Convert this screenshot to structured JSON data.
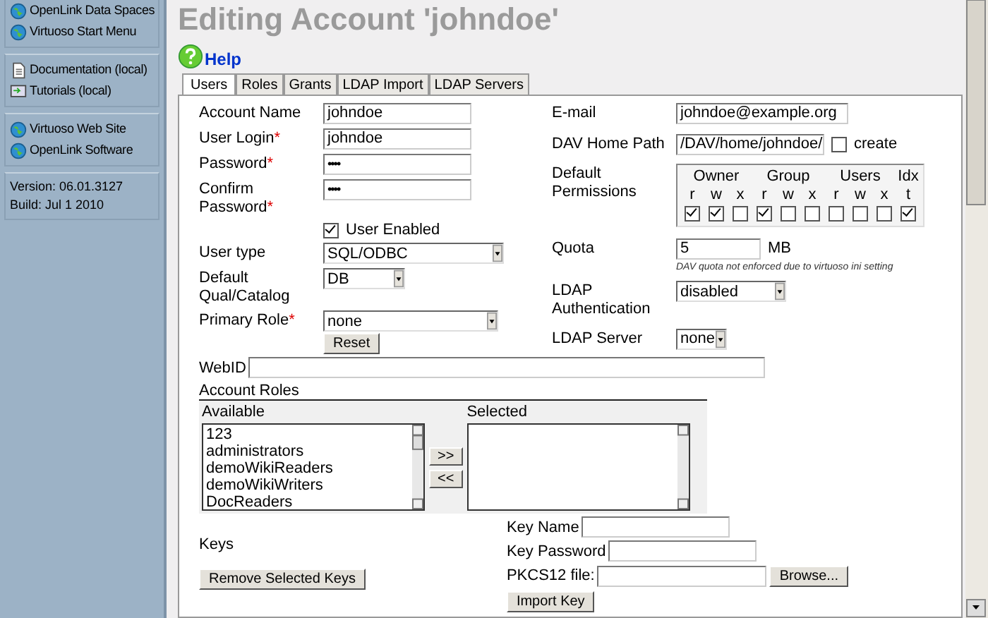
{
  "sidebar": {
    "groups": [
      {
        "items": [
          {
            "label": "OpenLink Data Spaces",
            "kind": "globe"
          },
          {
            "label": "Virtuoso Start Menu",
            "kind": "globe"
          }
        ]
      },
      {
        "items": [
          {
            "label": "Documentation (local)",
            "kind": "document"
          },
          {
            "label": "Tutorials (local)",
            "kind": "tutorial"
          }
        ]
      },
      {
        "items": [
          {
            "label": "Virtuoso Web Site",
            "kind": "globe"
          },
          {
            "label": "OpenLink Software",
            "kind": "globe"
          }
        ]
      }
    ],
    "version": [
      "Version: 06.01.3127",
      "Build: Jul 1 2010"
    ]
  },
  "title": "Editing Account 'johndoe'",
  "help": "Help",
  "tabs": [
    {
      "label": "Users",
      "selected": true
    },
    {
      "label": "Roles",
      "selected": false
    },
    {
      "label": "Grants",
      "selected": false
    },
    {
      "label": "LDAP Import",
      "selected": false
    },
    {
      "label": "LDAP Servers",
      "selected": false
    }
  ],
  "left_fields": [
    {
      "kind": "text",
      "label": "Account Name",
      "value": "johndoe"
    },
    {
      "kind": "text",
      "label": "User Login",
      "mark": "*",
      "value": "johndoe"
    },
    {
      "kind": "password",
      "label": "Password",
      "mark": "*",
      "value": "••••"
    },
    {
      "kind": "password",
      "label": "Confirm Password",
      "mark": "*",
      "value": "••••"
    },
    {
      "kind": "checkbox",
      "label": "User Enabled",
      "checked": true
    },
    {
      "kind": "select",
      "label": "User type",
      "value": "SQL/ODBC"
    },
    {
      "kind": "select",
      "label": "Default Qual/Catalog",
      "value": "DB"
    },
    {
      "kind": "select",
      "label": "Primary Role",
      "mark": "*",
      "value": "none",
      "button": "Reset"
    }
  ],
  "right_fields": [
    {
      "kind": "text",
      "label": "E-mail",
      "value": "johndoe@example.org"
    },
    {
      "kind": "text",
      "label": "DAV Home Path",
      "value": "/DAV/home/johndoe/",
      "option": {
        "label": "create",
        "checked": false
      }
    },
    {
      "kind": "permissions",
      "label": "Default Permissions",
      "groups": [
        "Owner",
        "Group",
        "Users",
        "Idx"
      ],
      "bits": [
        {
          "letter": "r",
          "checked": true
        },
        {
          "letter": "w",
          "checked": true
        },
        {
          "letter": "x",
          "checked": false
        },
        {
          "letter": "r",
          "checked": true
        },
        {
          "letter": "w",
          "checked": false
        },
        {
          "letter": "x",
          "checked": false
        },
        {
          "letter": "r",
          "checked": false
        },
        {
          "letter": "w",
          "checked": false
        },
        {
          "letter": "x",
          "checked": false
        },
        {
          "letter": "t",
          "checked": true
        }
      ]
    },
    {
      "kind": "quota",
      "label": "Quota",
      "value": "5",
      "unit": "MB",
      "note": "DAV quota not enforced due to virtuoso ini setting"
    },
    {
      "kind": "select",
      "label": "LDAP Authentication",
      "value": "disabled"
    },
    {
      "kind": "select",
      "label": "LDAP Server",
      "value": "none"
    }
  ],
  "webid": {
    "label": "WebID"
  },
  "roles": {
    "title": "Account Roles",
    "available_label": "Available",
    "selected_label": "Selected",
    "available": [
      "123",
      "administrators",
      "demoWikiReaders",
      "demoWikiWriters",
      "DocReaders"
    ],
    "add": ">>",
    "remove": "<<"
  },
  "keys": {
    "label": "Keys",
    "remove_button": "Remove Selected Keys",
    "key_name": "Key Name",
    "key_password": "Key Password",
    "pkcs12": "PKCS12 file:",
    "browse": "Browse...",
    "import_button": "Import Key"
  }
}
